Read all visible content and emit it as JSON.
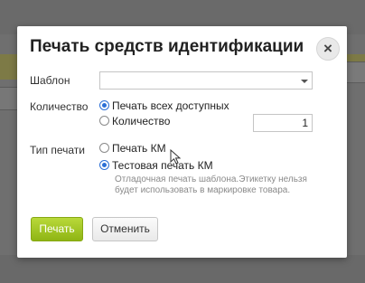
{
  "dialog": {
    "title": "Печать средств идентификации",
    "close_icon": "×",
    "template": {
      "label": "Шаблон",
      "value": ""
    },
    "quantity": {
      "label": "Количество",
      "option_all": "Печать всех доступных",
      "option_count": "Количество",
      "selected": "option_all",
      "count_value": "1"
    },
    "print_type": {
      "label": "Тип печати",
      "option_km": "Печать КМ",
      "option_test": "Тестовая печать КМ",
      "selected": "option_test",
      "hint": "Отладочная печать шаблона.Этикетку нельзя будет использовать в маркировке товара."
    },
    "buttons": {
      "print": "Печать",
      "cancel": "Отменить"
    }
  },
  "colors": {
    "print_button": "#9bc21e",
    "radio_selected": "#2b6fd6",
    "overlay": "#6f6f6f"
  }
}
